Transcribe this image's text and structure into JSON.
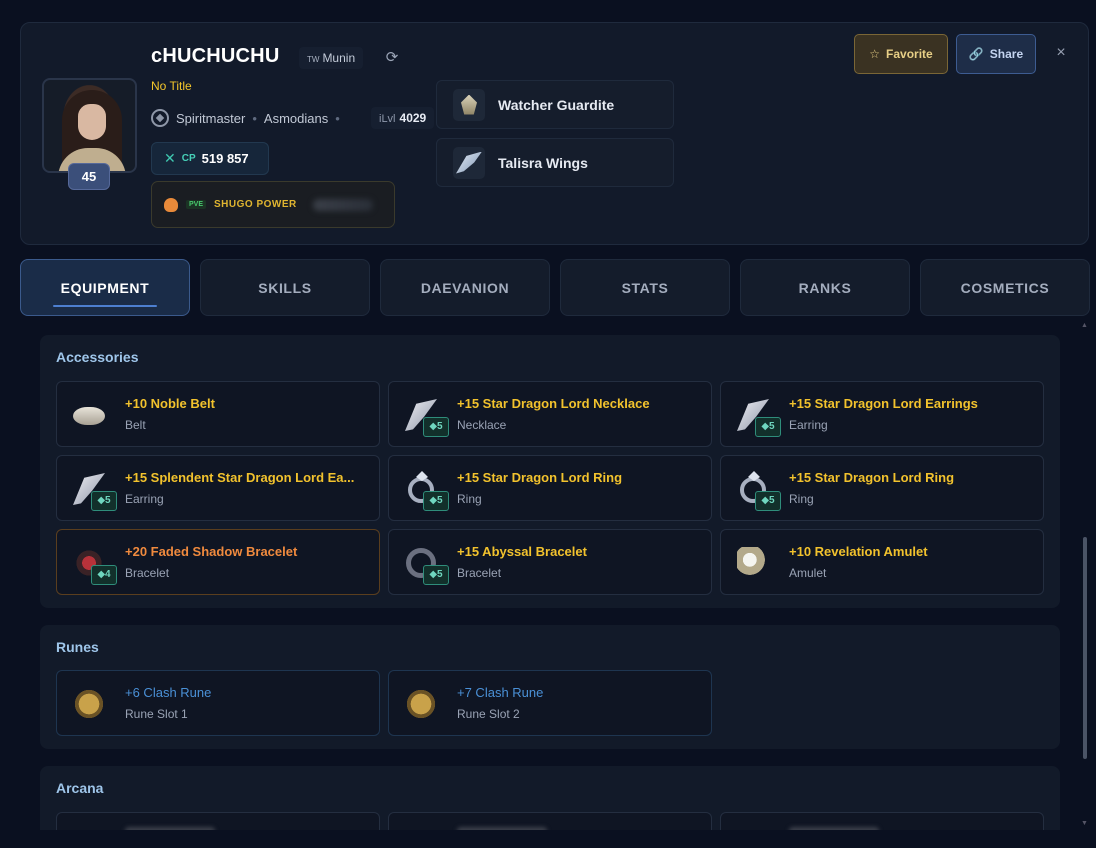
{
  "profile": {
    "name": "cHUCHUCHU",
    "server_region": "TW",
    "server_name": "Munin",
    "title": "No Title",
    "class": "Spiritmaster",
    "race": "Asmodians",
    "ilvl_label": "iLvl",
    "ilvl_value": "4029",
    "level": "45",
    "cp_label": "CP",
    "cp_value": "519 857",
    "shugo_tag": "PVE",
    "shugo_label": "SHUGO POWER"
  },
  "equipped_extras": [
    {
      "name": "Watcher Guardite",
      "icon": "glider-icon"
    },
    {
      "name": "Talisra Wings",
      "icon": "wings-icon"
    }
  ],
  "actions": {
    "favorite": "Favorite",
    "share": "Share",
    "close": "×"
  },
  "tabs": [
    "EQUIPMENT",
    "SKILLS",
    "DAEVANION",
    "STATS",
    "RANKS",
    "COSMETICS"
  ],
  "active_tab": "EQUIPMENT",
  "sections": {
    "accessories": {
      "title": "Accessories",
      "items": [
        {
          "name": "+10 Noble Belt",
          "type": "Belt",
          "enh": "",
          "icon": "belt-icon",
          "rarity_color": "#f2c22d"
        },
        {
          "name": "+15 Star Dragon Lord Necklace",
          "type": "Necklace",
          "enh": "◆5",
          "icon": "necklace-icon",
          "rarity_color": "#f2c22d"
        },
        {
          "name": "+15 Star Dragon Lord Earrings",
          "type": "Earring",
          "enh": "◆5",
          "icon": "earring-icon",
          "rarity_color": "#f2c22d"
        },
        {
          "name": "+15 Splendent Star Dragon Lord Ea...",
          "type": "Earring",
          "enh": "◆5",
          "icon": "earring-icon",
          "rarity_color": "#f2c22d"
        },
        {
          "name": "+15 Star Dragon Lord Ring",
          "type": "Ring",
          "enh": "◆5",
          "icon": "ring-icon",
          "rarity_color": "#f2c22d"
        },
        {
          "name": "+15 Star Dragon Lord Ring",
          "type": "Ring",
          "enh": "◆5",
          "icon": "ring-icon",
          "rarity_color": "#f2c22d"
        },
        {
          "name": "+20 Faded Shadow Bracelet",
          "type": "Bracelet",
          "enh": "◆4",
          "icon": "bracelet-icon",
          "rarity_color": "#f08a3e"
        },
        {
          "name": "+15 Abyssal Bracelet",
          "type": "Bracelet",
          "enh": "◆5",
          "icon": "bracelet-icon",
          "rarity_color": "#f2c22d"
        },
        {
          "name": "+10 Revelation Amulet",
          "type": "Amulet",
          "enh": "",
          "icon": "amulet-icon",
          "rarity_color": "#f2c22d"
        }
      ]
    },
    "runes": {
      "title": "Runes",
      "items": [
        {
          "name": "+6 Clash Rune",
          "type": "Rune Slot 1",
          "icon": "rune-icon"
        },
        {
          "name": "+7 Clash Rune",
          "type": "Rune Slot 2",
          "icon": "rune-icon"
        }
      ]
    },
    "arcana": {
      "title": "Arcana"
    }
  }
}
